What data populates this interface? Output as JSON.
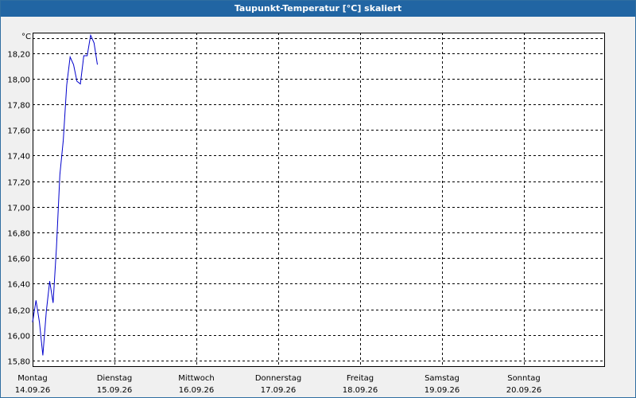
{
  "chart_data": {
    "type": "line",
    "title": "Taupunkt-Temperatur [°C] skaliert",
    "unit_label": "°C",
    "ylim": [
      15.75,
      18.36
    ],
    "y_ticks": [
      "15,80",
      "16,00",
      "16,20",
      "16,40",
      "16,60",
      "16,80",
      "17,00",
      "17,20",
      "17,40",
      "17,60",
      "17,80",
      "18,00",
      "18,20"
    ],
    "y_tick_values": [
      15.8,
      16.0,
      16.2,
      16.4,
      16.6,
      16.8,
      17.0,
      17.2,
      17.4,
      17.6,
      17.8,
      18.0,
      18.2
    ],
    "days": [
      {
        "weekday": "Montag",
        "date": "14.09.26"
      },
      {
        "weekday": "Dienstag",
        "date": "15.09.26"
      },
      {
        "weekday": "Mittwoch",
        "date": "16.09.26"
      },
      {
        "weekday": "Donnerstag",
        "date": "17.09.26"
      },
      {
        "weekday": "Freitag",
        "date": "18.09.26"
      },
      {
        "weekday": "Samstag",
        "date": "19.09.26"
      },
      {
        "weekday": "Sonntag",
        "date": "20.09.26"
      }
    ],
    "grid": true,
    "line_color": "#0000cc",
    "series": [
      {
        "x": [
          "14.09.26 00:00",
          "14.09.26 01:00",
          "14.09.26 02:00",
          "14.09.26 03:00",
          "14.09.26 04:00",
          "14.09.26 05:00",
          "14.09.26 06:00",
          "14.09.26 07:00",
          "14.09.26 08:00",
          "14.09.26 09:00",
          "14.09.26 10:00",
          "14.09.26 11:00",
          "14.09.26 12:00",
          "14.09.26 13:00",
          "14.09.26 14:00",
          "14.09.26 15:00",
          "14.09.26 16:00",
          "14.09.26 17:00",
          "14.09.26 18:00",
          "14.09.26 19:00",
          "14.09.26 20:00",
          "14.09.26 21:00",
          "14.09.26 22:00",
          "14.09.26 23:00"
        ],
        "y": [
          16.1,
          16.27,
          16.1,
          15.84,
          16.18,
          16.42,
          16.25,
          16.68,
          17.25,
          17.52,
          17.95,
          18.17,
          18.11,
          17.98,
          17.96,
          18.18,
          18.18,
          18.34,
          18.28,
          18.11,
          null,
          null,
          null,
          null
        ]
      }
    ]
  }
}
